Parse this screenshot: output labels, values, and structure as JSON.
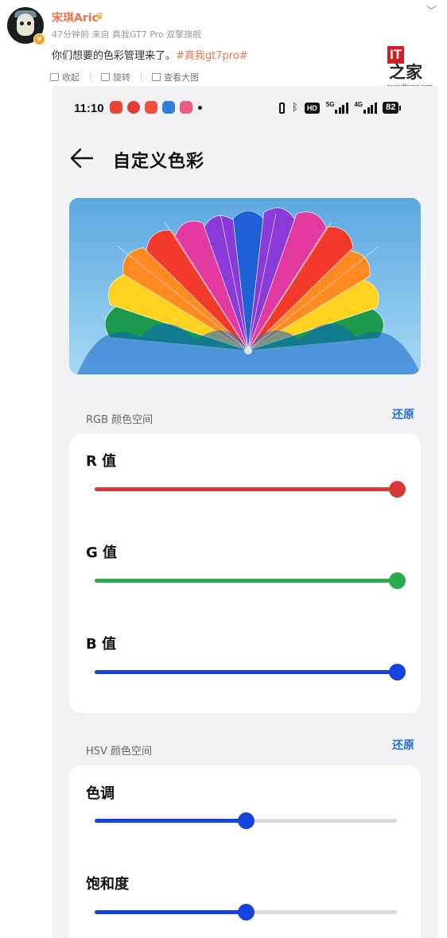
{
  "post": {
    "author": "宋琪Aric",
    "meta": "47分钟前 来自 真我GT7 Pro 双擎旗舰",
    "text": "你们想要的色彩管理来了。",
    "hashtag": "#真我gt7pro#",
    "actions": [
      "收起",
      "旋转",
      "查看大图"
    ]
  },
  "watermark": {
    "logo_text": "IT",
    "logo_zh": "之家",
    "url": "www.ithome.com"
  },
  "status_bar": {
    "time": "11:10",
    "hd": "HD",
    "net1": "5G",
    "net2": "4G",
    "battery": "82"
  },
  "screen": {
    "title": "自定义色彩",
    "rgb_section": {
      "label": "RGB 颜色空间",
      "reset": "还原",
      "sliders": [
        {
          "label": "R 值",
          "value": 1.0,
          "color": "#d93a33"
        },
        {
          "label": "G 值",
          "value": 1.0,
          "color": "#2aaa4a"
        },
        {
          "label": "B 值",
          "value": 1.0,
          "color": "#1444e0"
        }
      ]
    },
    "hsv_section": {
      "label": "HSV 颜色空间",
      "reset": "还原",
      "sliders": [
        {
          "label": "色调",
          "value": 0.5,
          "color": "#1444e0"
        },
        {
          "label": "饱和度",
          "value": 0.5,
          "color": "#1444e0"
        }
      ]
    }
  },
  "icons": [
    "chevron-down-icon",
    "collapse-icon",
    "rotate-icon",
    "view-large-icon",
    "back-arrow-icon",
    "bluetooth-icon",
    "vibrate-icon",
    "battery-icon"
  ]
}
